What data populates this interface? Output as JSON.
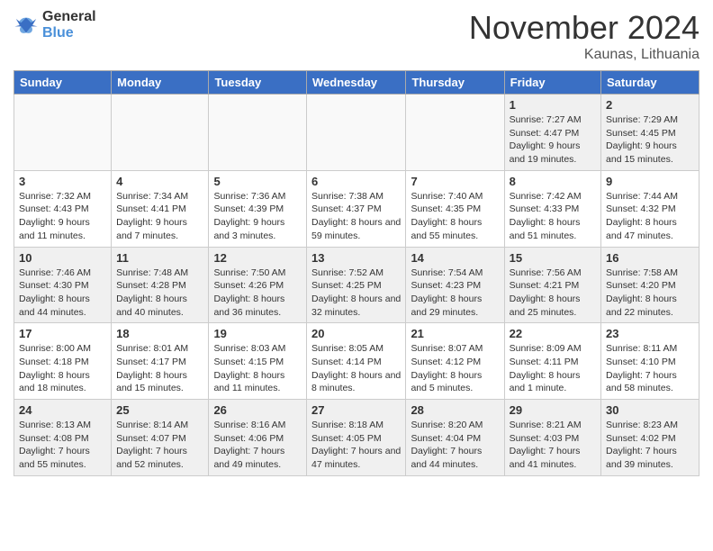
{
  "header": {
    "logo_general": "General",
    "logo_blue": "Blue",
    "month_title": "November 2024",
    "location": "Kaunas, Lithuania"
  },
  "days_of_week": [
    "Sunday",
    "Monday",
    "Tuesday",
    "Wednesday",
    "Thursday",
    "Friday",
    "Saturday"
  ],
  "weeks": [
    [
      {
        "day": "",
        "empty": true
      },
      {
        "day": "",
        "empty": true
      },
      {
        "day": "",
        "empty": true
      },
      {
        "day": "",
        "empty": true
      },
      {
        "day": "",
        "empty": true
      },
      {
        "day": "1",
        "sunrise": "Sunrise: 7:27 AM",
        "sunset": "Sunset: 4:47 PM",
        "daylight": "Daylight: 9 hours and 19 minutes."
      },
      {
        "day": "2",
        "sunrise": "Sunrise: 7:29 AM",
        "sunset": "Sunset: 4:45 PM",
        "daylight": "Daylight: 9 hours and 15 minutes."
      }
    ],
    [
      {
        "day": "3",
        "sunrise": "Sunrise: 7:32 AM",
        "sunset": "Sunset: 4:43 PM",
        "daylight": "Daylight: 9 hours and 11 minutes."
      },
      {
        "day": "4",
        "sunrise": "Sunrise: 7:34 AM",
        "sunset": "Sunset: 4:41 PM",
        "daylight": "Daylight: 9 hours and 7 minutes."
      },
      {
        "day": "5",
        "sunrise": "Sunrise: 7:36 AM",
        "sunset": "Sunset: 4:39 PM",
        "daylight": "Daylight: 9 hours and 3 minutes."
      },
      {
        "day": "6",
        "sunrise": "Sunrise: 7:38 AM",
        "sunset": "Sunset: 4:37 PM",
        "daylight": "Daylight: 8 hours and 59 minutes."
      },
      {
        "day": "7",
        "sunrise": "Sunrise: 7:40 AM",
        "sunset": "Sunset: 4:35 PM",
        "daylight": "Daylight: 8 hours and 55 minutes."
      },
      {
        "day": "8",
        "sunrise": "Sunrise: 7:42 AM",
        "sunset": "Sunset: 4:33 PM",
        "daylight": "Daylight: 8 hours and 51 minutes."
      },
      {
        "day": "9",
        "sunrise": "Sunrise: 7:44 AM",
        "sunset": "Sunset: 4:32 PM",
        "daylight": "Daylight: 8 hours and 47 minutes."
      }
    ],
    [
      {
        "day": "10",
        "sunrise": "Sunrise: 7:46 AM",
        "sunset": "Sunset: 4:30 PM",
        "daylight": "Daylight: 8 hours and 44 minutes."
      },
      {
        "day": "11",
        "sunrise": "Sunrise: 7:48 AM",
        "sunset": "Sunset: 4:28 PM",
        "daylight": "Daylight: 8 hours and 40 minutes."
      },
      {
        "day": "12",
        "sunrise": "Sunrise: 7:50 AM",
        "sunset": "Sunset: 4:26 PM",
        "daylight": "Daylight: 8 hours and 36 minutes."
      },
      {
        "day": "13",
        "sunrise": "Sunrise: 7:52 AM",
        "sunset": "Sunset: 4:25 PM",
        "daylight": "Daylight: 8 hours and 32 minutes."
      },
      {
        "day": "14",
        "sunrise": "Sunrise: 7:54 AM",
        "sunset": "Sunset: 4:23 PM",
        "daylight": "Daylight: 8 hours and 29 minutes."
      },
      {
        "day": "15",
        "sunrise": "Sunrise: 7:56 AM",
        "sunset": "Sunset: 4:21 PM",
        "daylight": "Daylight: 8 hours and 25 minutes."
      },
      {
        "day": "16",
        "sunrise": "Sunrise: 7:58 AM",
        "sunset": "Sunset: 4:20 PM",
        "daylight": "Daylight: 8 hours and 22 minutes."
      }
    ],
    [
      {
        "day": "17",
        "sunrise": "Sunrise: 8:00 AM",
        "sunset": "Sunset: 4:18 PM",
        "daylight": "Daylight: 8 hours and 18 minutes."
      },
      {
        "day": "18",
        "sunrise": "Sunrise: 8:01 AM",
        "sunset": "Sunset: 4:17 PM",
        "daylight": "Daylight: 8 hours and 15 minutes."
      },
      {
        "day": "19",
        "sunrise": "Sunrise: 8:03 AM",
        "sunset": "Sunset: 4:15 PM",
        "daylight": "Daylight: 8 hours and 11 minutes."
      },
      {
        "day": "20",
        "sunrise": "Sunrise: 8:05 AM",
        "sunset": "Sunset: 4:14 PM",
        "daylight": "Daylight: 8 hours and 8 minutes."
      },
      {
        "day": "21",
        "sunrise": "Sunrise: 8:07 AM",
        "sunset": "Sunset: 4:12 PM",
        "daylight": "Daylight: 8 hours and 5 minutes."
      },
      {
        "day": "22",
        "sunrise": "Sunrise: 8:09 AM",
        "sunset": "Sunset: 4:11 PM",
        "daylight": "Daylight: 8 hours and 1 minute."
      },
      {
        "day": "23",
        "sunrise": "Sunrise: 8:11 AM",
        "sunset": "Sunset: 4:10 PM",
        "daylight": "Daylight: 7 hours and 58 minutes."
      }
    ],
    [
      {
        "day": "24",
        "sunrise": "Sunrise: 8:13 AM",
        "sunset": "Sunset: 4:08 PM",
        "daylight": "Daylight: 7 hours and 55 minutes."
      },
      {
        "day": "25",
        "sunrise": "Sunrise: 8:14 AM",
        "sunset": "Sunset: 4:07 PM",
        "daylight": "Daylight: 7 hours and 52 minutes."
      },
      {
        "day": "26",
        "sunrise": "Sunrise: 8:16 AM",
        "sunset": "Sunset: 4:06 PM",
        "daylight": "Daylight: 7 hours and 49 minutes."
      },
      {
        "day": "27",
        "sunrise": "Sunrise: 8:18 AM",
        "sunset": "Sunset: 4:05 PM",
        "daylight": "Daylight: 7 hours and 47 minutes."
      },
      {
        "day": "28",
        "sunrise": "Sunrise: 8:20 AM",
        "sunset": "Sunset: 4:04 PM",
        "daylight": "Daylight: 7 hours and 44 minutes."
      },
      {
        "day": "29",
        "sunrise": "Sunrise: 8:21 AM",
        "sunset": "Sunset: 4:03 PM",
        "daylight": "Daylight: 7 hours and 41 minutes."
      },
      {
        "day": "30",
        "sunrise": "Sunrise: 8:23 AM",
        "sunset": "Sunset: 4:02 PM",
        "daylight": "Daylight: 7 hours and 39 minutes."
      }
    ]
  ]
}
